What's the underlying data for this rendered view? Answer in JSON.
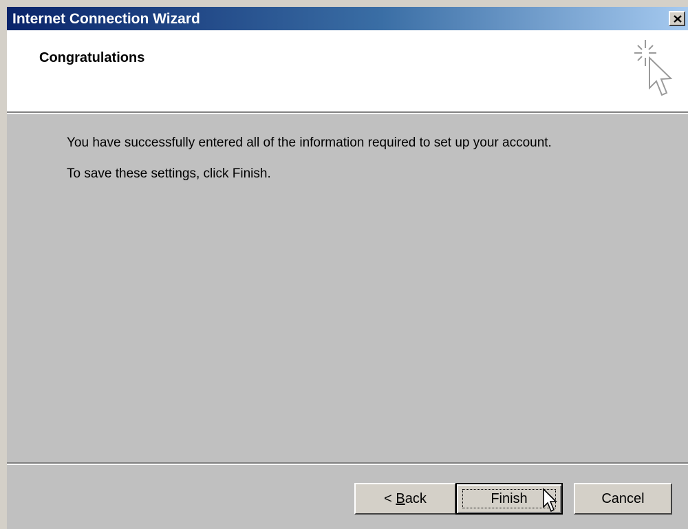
{
  "window": {
    "title": "Internet Connection Wizard",
    "close_icon": "close-icon"
  },
  "header": {
    "title": "Congratulations",
    "icon": "wizard-cursor-sparkle-icon"
  },
  "content": {
    "line1": "You have successfully entered all of the information required to set up your account.",
    "line2": "To save these settings, click Finish."
  },
  "buttons": {
    "back_prefix": "< ",
    "back_accel": "B",
    "back_rest": "ack",
    "finish": "Finish",
    "cancel": "Cancel"
  },
  "colors": {
    "titlebar_start": "#0a246a",
    "titlebar_end": "#a6caf0",
    "face": "#c0c0c0"
  }
}
